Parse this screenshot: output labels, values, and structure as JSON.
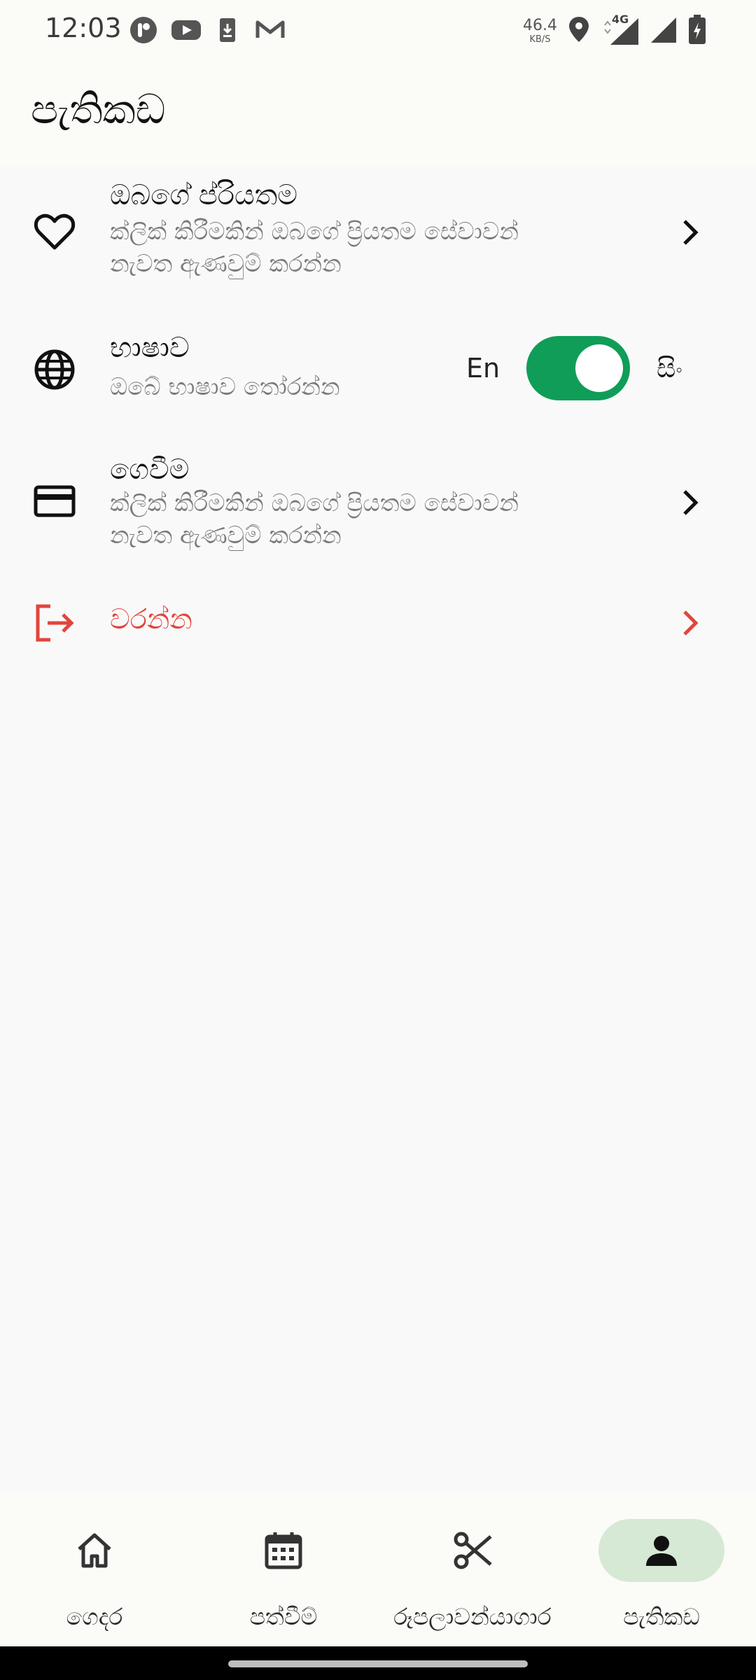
{
  "status_bar": {
    "time": "12:03",
    "speed_value": "46.4",
    "speed_unit": "KB/S",
    "network": "4G"
  },
  "header": {
    "title": "පැතිකඩ"
  },
  "settings": {
    "favorites": {
      "title": "ඔබගේ ප්රියතම",
      "subtitle_line1": "ක්ලික් කිරීමකින් ඔබගේ ප්‍රියතම සේවාවන්",
      "subtitle_line2": "නැවත ඇණවුම් කරන්න",
      "icon": "heart-icon"
    },
    "language": {
      "title": "භාෂාව",
      "subtitle": "ඔබේ භාෂාව තෝරන්න",
      "option_left": "En",
      "option_right": "සිං",
      "toggle_on": true,
      "icon": "globe-icon"
    },
    "payment": {
      "title": "ගෙවීම",
      "subtitle_line1": "ක්ලික් කිරීමකින් ඔබගේ ප්‍රියතම සේවාවන්",
      "subtitle_line2": "නැවත ඇණවුම් කරන්න",
      "icon": "credit-card-icon"
    },
    "logout": {
      "label": "වරන්න",
      "icon": "logout-icon",
      "color": "#e2453c"
    }
  },
  "bottom_nav": {
    "items": [
      {
        "label": "ගෙදර",
        "icon": "home-icon",
        "active": false
      },
      {
        "label": "පත්වීම්",
        "icon": "calendar-icon",
        "active": false
      },
      {
        "label": "රූපලාවන්යාගාර",
        "icon": "scissors-icon",
        "active": false
      },
      {
        "label": "පැතිකඩ",
        "icon": "person-icon",
        "active": true
      }
    ],
    "active_color": "#d6e9d5"
  },
  "colors": {
    "accent": "#0f9d58",
    "danger": "#e2453c",
    "background": "#f9f9f9"
  }
}
